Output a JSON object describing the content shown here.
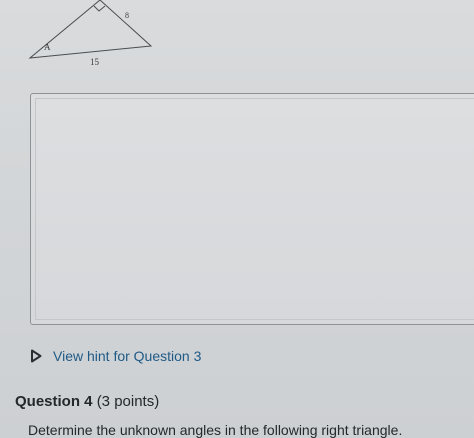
{
  "figure": {
    "vertex_label": "A",
    "side_label_short": "8",
    "side_label_base": "15"
  },
  "answer_box": {
    "value": ""
  },
  "hint": {
    "icon": "caret-right-icon",
    "label": "View hint for Question 3"
  },
  "question": {
    "title": "Question 4",
    "points": "(3 points)",
    "text": "Determine the unknown angles in the following right triangle."
  },
  "colors": {
    "link": "#1f5a86",
    "text": "#25282b",
    "background": "#d6d8db",
    "box_border": "#8f9397"
  }
}
